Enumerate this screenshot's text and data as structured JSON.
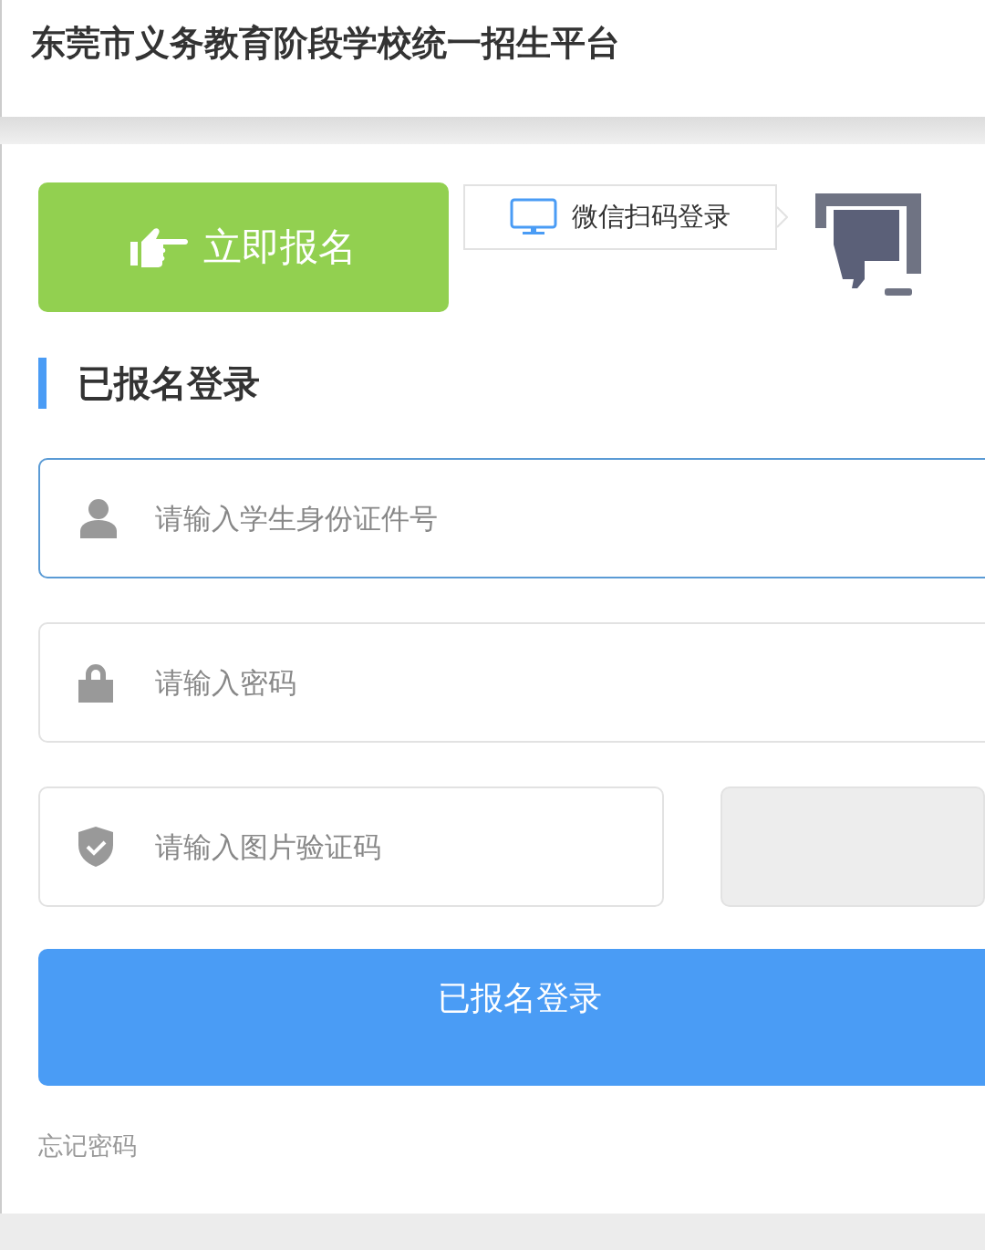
{
  "header": {
    "title": "东莞市义务教育阶段学校统一招生平台"
  },
  "register_button": {
    "label": "立即报名"
  },
  "wechat_tooltip": {
    "label": "微信扫码登录"
  },
  "section": {
    "title": "已报名登录"
  },
  "fields": [
    {
      "kind": "id",
      "placeholder": "请输入学生身份证件号",
      "focused": true
    },
    {
      "kind": "password",
      "placeholder": "请输入密码",
      "focused": false
    },
    {
      "kind": "captcha",
      "placeholder": "请输入图片验证码",
      "focused": false
    }
  ],
  "login_button": {
    "label": "已报名登录"
  },
  "forgot_link": {
    "label": "忘记密码"
  }
}
